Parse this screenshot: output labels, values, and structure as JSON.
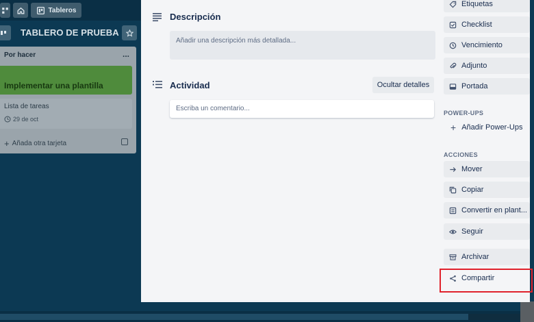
{
  "topbar": {
    "boards_label": "Tableros"
  },
  "board": {
    "title": "TABLERO DE PRUEBA"
  },
  "list": {
    "title": "Por hacer",
    "menu_label": "...",
    "cards": [
      {
        "title": "Implementar una plantilla"
      },
      {
        "title": "Lista de tareas",
        "due": "29 de oct"
      }
    ],
    "add_card_label": "Añada otra tarjeta"
  },
  "modal": {
    "description": {
      "title": "Descripción",
      "placeholder": "Añadir una descripción más detallada..."
    },
    "activity": {
      "title": "Actividad",
      "hide_details_label": "Ocultar detalles",
      "comment_placeholder": "Escriba un comentario..."
    },
    "sidebar": {
      "add_items": [
        {
          "label": "Etiquetas",
          "icon": "tag-icon"
        },
        {
          "label": "Checklist",
          "icon": "checklist-icon"
        },
        {
          "label": "Vencimiento",
          "icon": "clock-icon"
        },
        {
          "label": "Adjunto",
          "icon": "paperclip-icon"
        },
        {
          "label": "Portada",
          "icon": "cover-icon"
        }
      ],
      "powerups_heading": "POWER-UPS",
      "add_powerups_label": "Añadir Power-Ups",
      "actions_heading": "ACCIONES",
      "actions": [
        {
          "label": "Mover",
          "icon": "arrow-right-icon"
        },
        {
          "label": "Copiar",
          "icon": "copy-icon"
        },
        {
          "label": "Convertir en plant...",
          "icon": "template-icon"
        },
        {
          "label": "Seguir",
          "icon": "eye-icon"
        },
        {
          "label": "Archivar",
          "icon": "archive-icon"
        },
        {
          "label": "Compartir",
          "icon": "share-icon"
        }
      ]
    }
  },
  "colors": {
    "board_bg": "#0c3953",
    "modal_bg": "#f4f5f7",
    "highlight_border": "#e0212b",
    "green_label": "#4f8b3c"
  }
}
